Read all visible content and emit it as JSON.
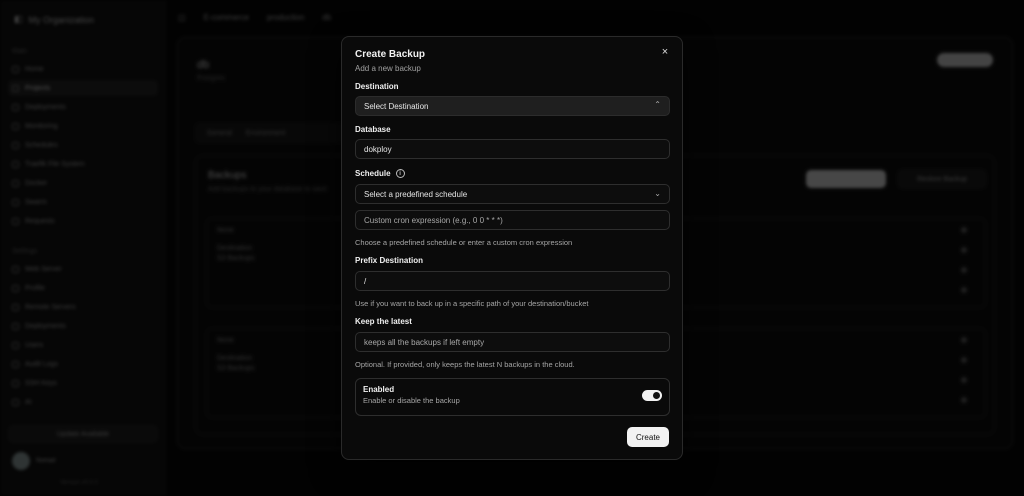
{
  "background": {
    "sidebar": {
      "org_name": "My Organization",
      "section_main": "Main",
      "main_items": [
        "Home",
        "Projects",
        "Deployments",
        "Monitoring",
        "Schedules",
        "Traefik File System",
        "Docker",
        "Swarm",
        "Requests"
      ],
      "active_item": "Projects",
      "section_settings": "Settings",
      "settings_items": [
        "Web Server",
        "Profile",
        "Remote Servers",
        "Deployments",
        "Users",
        "Audit Logs",
        "SSH Keys",
        "AI"
      ],
      "update_label": "Update Available",
      "user_name": "Nomad",
      "version": "Version v0.0.0"
    },
    "topbar": {
      "breadcrumbs": [
        "E-commerce",
        "production",
        "db"
      ]
    },
    "project": {
      "title": "db",
      "subtitle": "Postgres"
    },
    "tabs": [
      "General",
      "Environment"
    ],
    "backups_card": {
      "title": "Backups",
      "subtitle": "Add backups to your database to save",
      "restore_label": "Restore Backup",
      "rows": [
        {
          "name": "None",
          "dest_label": "Destination",
          "dest_value": "S3 Backups"
        },
        {
          "name": "None",
          "dest_label": "Destination",
          "dest_value": "S3 Backups"
        }
      ]
    }
  },
  "modal": {
    "title": "Create Backup",
    "subtitle": "Add a new backup",
    "destination": {
      "label": "Destination",
      "placeholder": "Select Destination"
    },
    "database": {
      "label": "Database",
      "value": "dokploy"
    },
    "schedule": {
      "label": "Schedule",
      "select_placeholder": "Select a predefined schedule",
      "cron_placeholder": "Custom cron expression (e.g., 0 0 * * *)",
      "help": "Choose a predefined schedule or enter a custom cron expression"
    },
    "prefix": {
      "label": "Prefix Destination",
      "value": "/",
      "help": "Use if you want to back up in a specific path of your destination/bucket"
    },
    "keep_latest": {
      "label": "Keep the latest",
      "placeholder": "keeps all the backups if left empty",
      "help": "Optional. If provided, only keeps the latest N backups in the cloud."
    },
    "enabled": {
      "label": "Enabled",
      "description": "Enable or disable the backup",
      "value": true
    },
    "create_label": "Create",
    "close_glyph": "×"
  }
}
